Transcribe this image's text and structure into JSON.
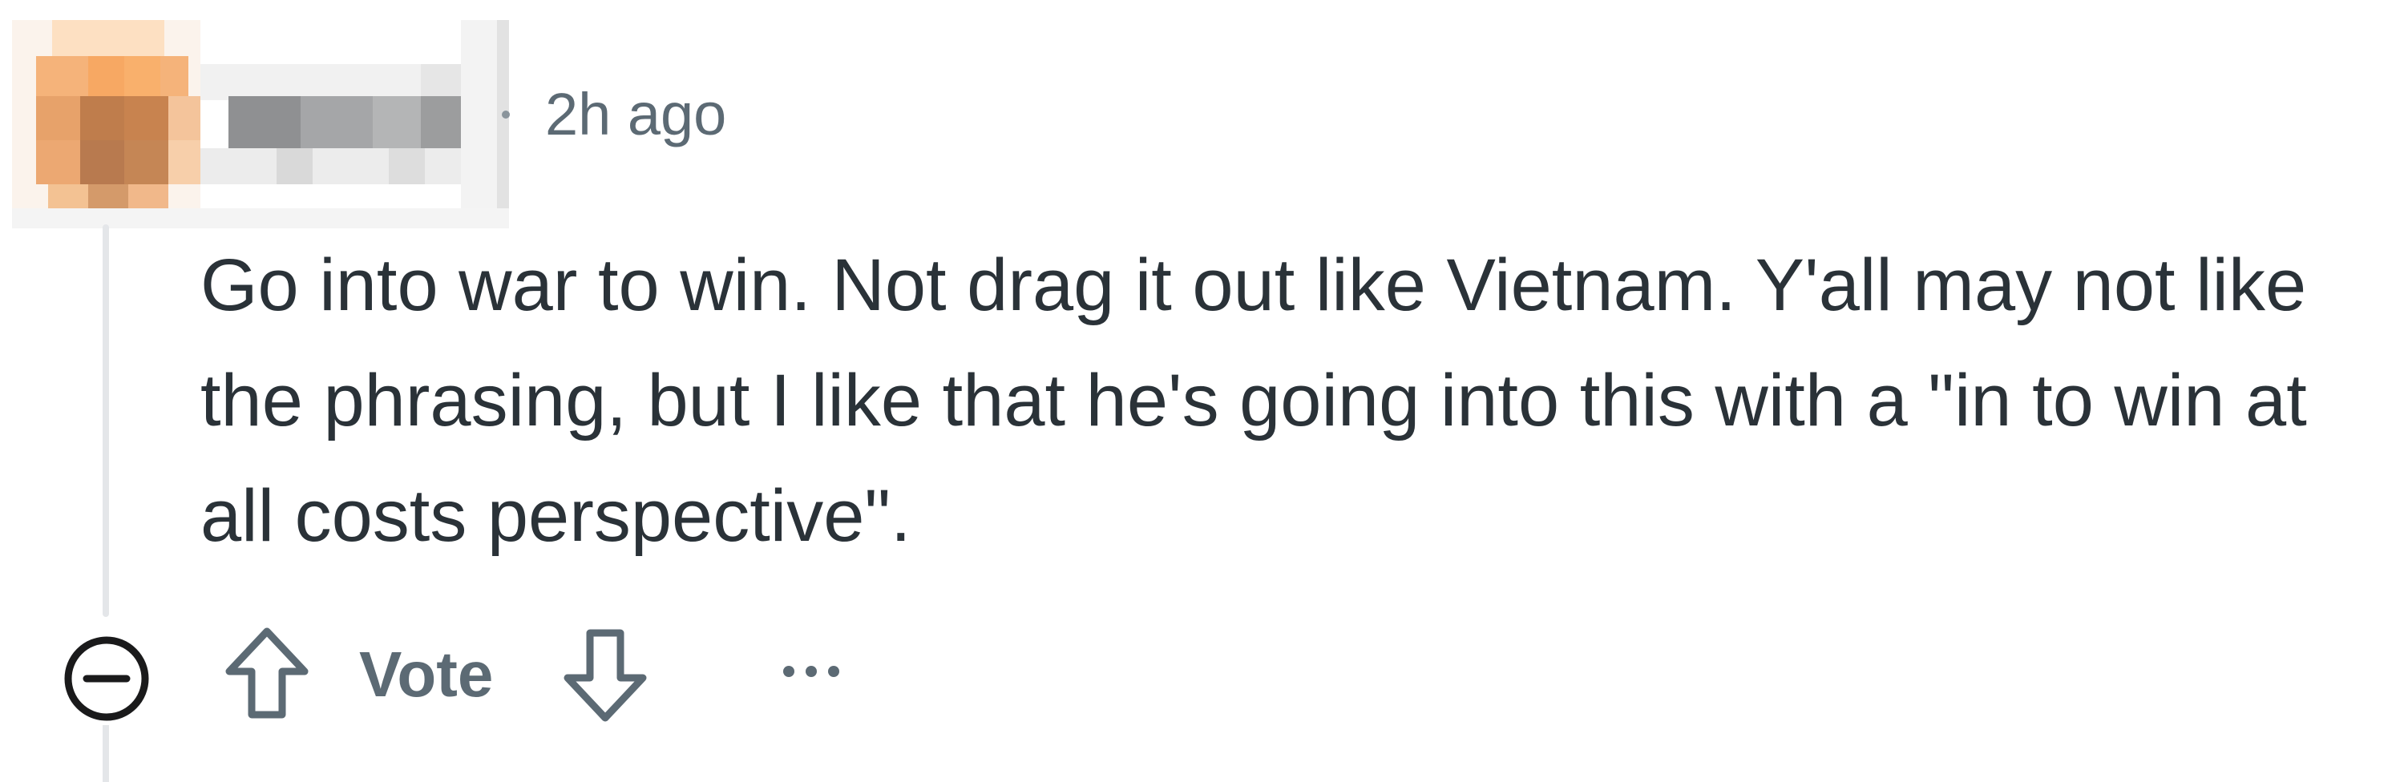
{
  "comment": {
    "author_redacted": true,
    "timestamp": "2h ago",
    "body": "Go into war to win. Not drag it out like Vietnam. Y'all may not like the phrasing, but I like that he's going into this with a \"in to win at all costs perspective\"."
  },
  "actions": {
    "collapse_icon": "collapse-minus-circle-icon",
    "upvote_icon": "arrow-up-outline-icon",
    "vote_label": "Vote",
    "downvote_icon": "arrow-down-outline-icon",
    "more_icon": "ellipsis-icon"
  },
  "colors": {
    "text": "#2a3238",
    "muted": "#5c6a74",
    "thread_line": "#e4e6e9",
    "avatar_tone": "#f0a45c"
  }
}
